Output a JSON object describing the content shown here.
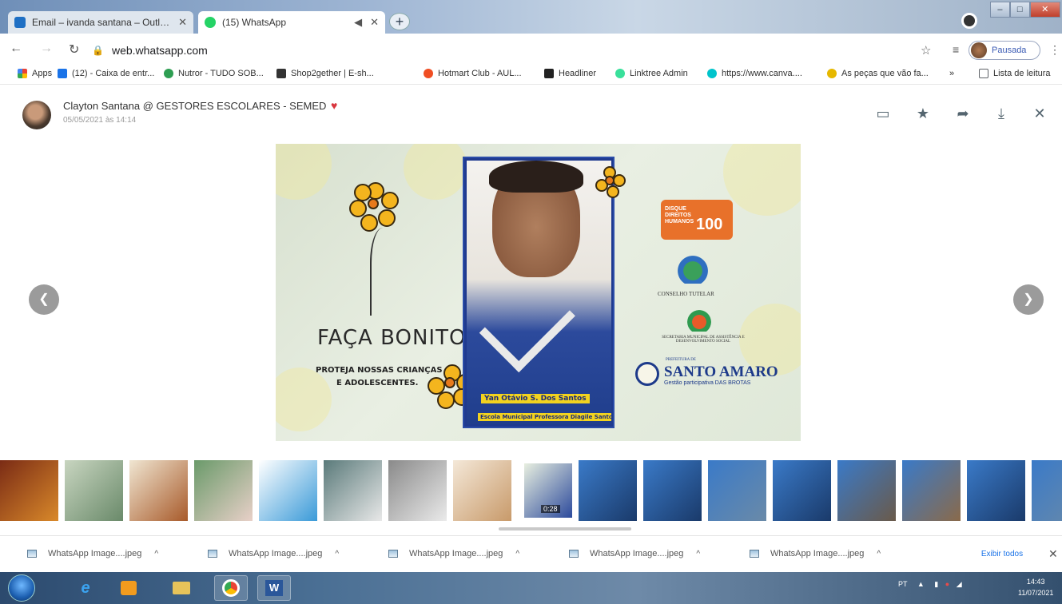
{
  "browser": {
    "tabs": [
      {
        "label": "Email – ivanda santana – Outlook",
        "color": "#1e6fc4",
        "active": false
      },
      {
        "label": "(15) WhatsApp",
        "color": "#25d366",
        "active": true
      }
    ],
    "url": "web.whatsapp.com",
    "profile_status": "Pausada",
    "bookmarks": [
      {
        "label": "Apps",
        "color": "#4285f4"
      },
      {
        "label": "(12) - Caixa de entr...",
        "color": "#1a73e8"
      },
      {
        "label": "Nutror - TUDO SOB...",
        "color": "#2e9e52"
      },
      {
        "label": "Shop2gether | E-sh...",
        "color": "#333333"
      },
      {
        "label": "Hotmart Club - AUL...",
        "color": "#f04e23"
      },
      {
        "label": "Headliner",
        "color": "#222222"
      },
      {
        "label": "Linktree Admin",
        "color": "#39e09b"
      },
      {
        "label": "https://www.canva....",
        "color": "#00c4cc"
      },
      {
        "label": "As peças que vão fa...",
        "color": "#e6b800"
      },
      {
        "label": "»",
        "color": ""
      },
      {
        "label": "Lista de leitura",
        "color": "#5f6368"
      }
    ]
  },
  "viewer": {
    "sender": "Clayton Santana @ GESTORES ESCOLARES - SEMED",
    "timestamp": "05/05/2021 às 14:14",
    "icons": [
      "comment-icon",
      "star-icon",
      "forward-icon",
      "download-icon",
      "close-icon"
    ]
  },
  "image": {
    "campaign_title": "FAÇA BONITO",
    "campaign_line1": "PROTEJA NOSSAS CRIANÇAS",
    "campaign_line2": "E ADOLESCENTES.",
    "student_name": "Yan Otávio S. Dos Santos",
    "school_name": "Escola Municipal Professora Diagile Santos Teles",
    "hotline_label": "DISQUE DIREITOS HUMANOS",
    "hotline_number": "100",
    "council_label": "CONSELHO TUTELAR",
    "secretariat_label": "SECRETARIA MUNICIPAL DE ASSISTÊNCIA E DESENVOLVIMENTO SOCIAL",
    "city_label": "SANTO AMARO",
    "city_prefix": "PREFEITURA DE",
    "city_subtitle": "Gestão participativa DAS BROTAS"
  },
  "thumbnails": [
    {
      "colors": [
        "#7a2b15",
        "#d9892a"
      ]
    },
    {
      "colors": [
        "#c8d5c0",
        "#6a8a6a"
      ]
    },
    {
      "colors": [
        "#f0e6d2",
        "#a85a2a"
      ]
    },
    {
      "colors": [
        "#6a9a6a",
        "#e8d0c8"
      ]
    },
    {
      "colors": [
        "#ffffff",
        "#3a9ad8"
      ]
    },
    {
      "colors": [
        "#5a7a7a",
        "#e8e8e8"
      ]
    },
    {
      "colors": [
        "#8a8a8a",
        "#eaeaea"
      ]
    },
    {
      "colors": [
        "#f4e8d8",
        "#c89a6a"
      ]
    },
    {
      "colors": [
        "#e8efe0",
        "#2c4a9c"
      ],
      "selected": true,
      "label": "0:28"
    },
    {
      "colors": [
        "#3a7ac8",
        "#1a3a6a"
      ]
    },
    {
      "colors": [
        "#3a7ac8",
        "#1a3a6a"
      ]
    },
    {
      "colors": [
        "#3a7ac8",
        "#6a8aa8"
      ]
    },
    {
      "colors": [
        "#3a7ac8",
        "#1a3a6a"
      ]
    },
    {
      "colors": [
        "#3a7ac8",
        "#6a5a4a"
      ]
    },
    {
      "colors": [
        "#3a7ac8",
        "#8a6a4a"
      ]
    },
    {
      "colors": [
        "#3a7ac8",
        "#1a3a6a"
      ]
    },
    {
      "colors": [
        "#3a7ac8",
        "#6a8aa8"
      ]
    }
  ],
  "downloads": {
    "items": [
      "WhatsApp Image....jpeg",
      "WhatsApp Image....jpeg",
      "WhatsApp Image....jpeg",
      "WhatsApp Image....jpeg",
      "WhatsApp Image....jpeg"
    ],
    "show_all": "Exibir todos"
  },
  "taskbar": {
    "language": "PT",
    "time": "14:43",
    "date": "11/07/2021"
  }
}
